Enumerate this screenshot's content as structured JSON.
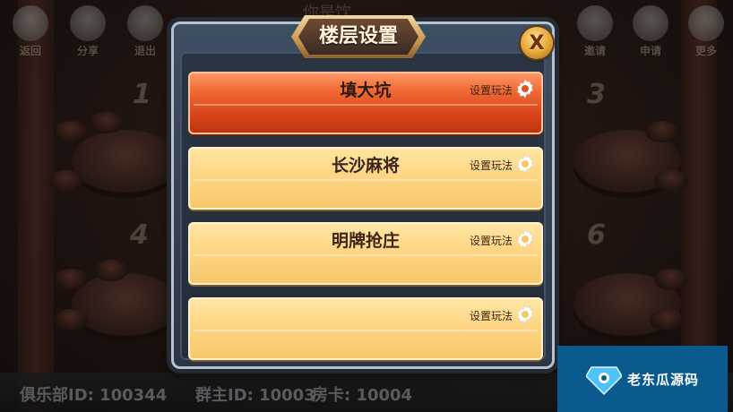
{
  "topbar": {
    "left_buttons": [
      {
        "label": "返回",
        "icon": "back-arrow-icon"
      },
      {
        "label": "分享",
        "icon": "share-icon"
      },
      {
        "label": "退出",
        "icon": "exit-icon"
      }
    ],
    "right_buttons": [
      {
        "label": "邀请",
        "icon": "invite-icon"
      },
      {
        "label": "申请",
        "icon": "apply-icon"
      },
      {
        "label": "更多",
        "icon": "more-icon"
      }
    ],
    "partial_banner": "你是饮"
  },
  "tables": {
    "numbers": [
      "1",
      "3",
      "4",
      "6"
    ]
  },
  "bottombar": {
    "club_id": "俱乐部ID: 100344",
    "group_id": "群主ID: 10003",
    "room_card": "房卡: 10004"
  },
  "dialog": {
    "title": "楼层设置",
    "close_label": "X",
    "floors": [
      {
        "name": "填大坑",
        "settings_label": "设置玩法",
        "active": true
      },
      {
        "name": "长沙麻将",
        "settings_label": "设置玩法",
        "active": false
      },
      {
        "name": "明牌抢庄",
        "settings_label": "设置玩法",
        "active": false
      },
      {
        "name": "",
        "settings_label": "设置玩法",
        "active": false
      }
    ]
  },
  "watermark": {
    "text": "老东瓜源码"
  },
  "colors": {
    "active_floor": "#e05022",
    "normal_floor": "#ffd98a",
    "dialog_bg": "#2b3442",
    "title_gold": "#c8964f"
  }
}
